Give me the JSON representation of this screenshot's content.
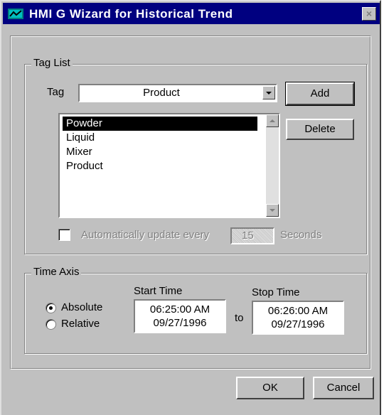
{
  "window": {
    "title": "HMI G Wizard for Historical Trend",
    "close_glyph": "×",
    "icon": "app-icon"
  },
  "tag_list": {
    "legend": "Tag List",
    "tag_label": "Tag",
    "tag_value": "Product",
    "add_label": "Add",
    "delete_label": "Delete",
    "items": [
      "Powder",
      "Liquid",
      "Mixer",
      "Product"
    ],
    "selected": "Powder",
    "auto_update_label": "Automatically update every",
    "auto_update_value": "15",
    "seconds_label": "Seconds",
    "auto_update_checked": false
  },
  "time_axis": {
    "legend": "Time Axis",
    "absolute_label": "Absolute",
    "relative_label": "Relative",
    "mode": "Absolute",
    "start_label": "Start Time",
    "start_time": "06:25:00 AM",
    "start_date": "09/27/1996",
    "to_label": "to",
    "stop_label": "Stop Time",
    "stop_time": "06:26:00 AM",
    "stop_date": "09/27/1996"
  },
  "buttons": {
    "ok": "OK",
    "cancel": "Cancel"
  },
  "colors": {
    "title_bar": "#000080",
    "face": "#c0c0c0",
    "selection": "#000000"
  }
}
